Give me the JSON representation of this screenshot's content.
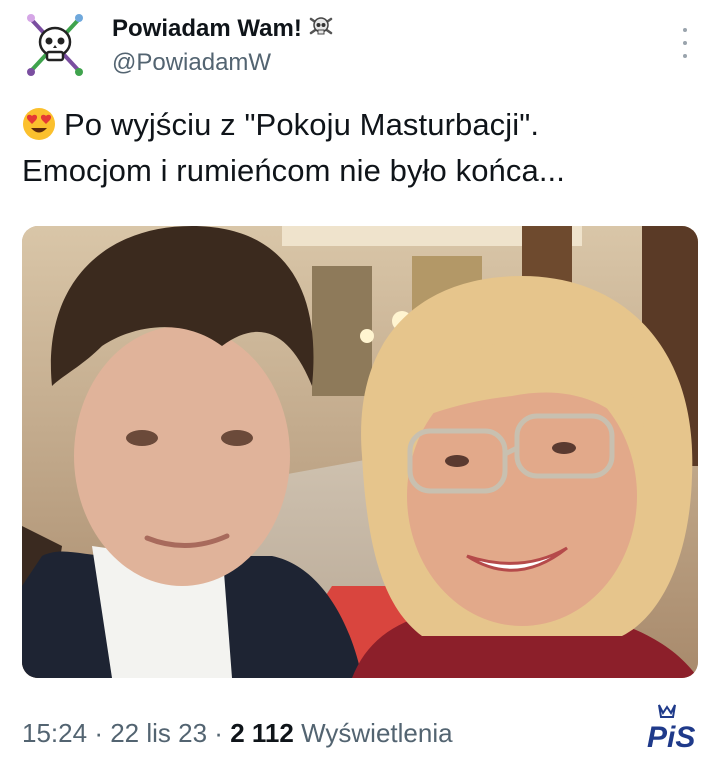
{
  "tweet": {
    "display_name": "Powiadam Wam!",
    "handle": "@PowiadamW",
    "text_line1": "Po wyjściu z \"Pokoju Masturbacji\".",
    "text_line2": "Emocjom i rumieńcom nie było końca...",
    "time": "15:24",
    "separator1": "·",
    "date": "22 lis 23",
    "separator2": "·",
    "views_count": "2 112",
    "views_label": "Wyświetlenia"
  },
  "watermark": {
    "text": "PiS"
  },
  "icons": {
    "avatar": "skull-crossbones-avatar-icon",
    "name_badge": "skull-crossbones-icon",
    "more": "more-dots-icon",
    "emoji": "heart-eyes-emoji-icon"
  },
  "colors": {
    "text_primary": "#0f1419",
    "text_secondary": "#536471",
    "watermark_blue": "#1f3a8a",
    "watermark_red": "#d0191e"
  }
}
